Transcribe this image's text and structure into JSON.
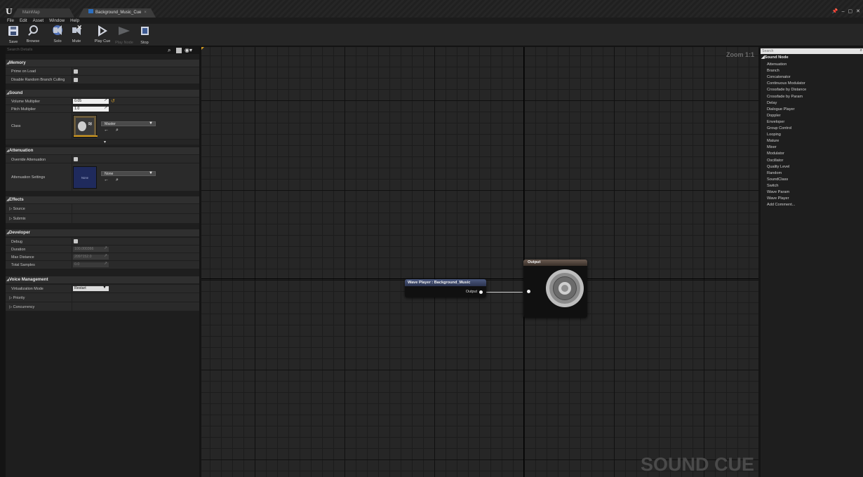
{
  "titlebar": {
    "tabs": [
      {
        "label": "MainMap"
      },
      {
        "label": "Background_Music_Cue",
        "close": "×"
      }
    ],
    "window_controls": {
      "pin": "📌",
      "minimize": "–",
      "maximize": "▢",
      "close": "✕"
    }
  },
  "menubar": [
    "File",
    "Edit",
    "Asset",
    "Window",
    "Help"
  ],
  "toolbar": {
    "save": "Save",
    "browse": "Browse",
    "solo": "Solo",
    "mute": "Mute",
    "play_cue": "Play Cue",
    "play_node": "Play Node",
    "stop": "Stop"
  },
  "details": {
    "search_placeholder": "Search Details",
    "categories": {
      "memory": "Memory",
      "sound": "Sound",
      "attenuation": "Attenuation",
      "effects": "Effects",
      "developer": "Developer",
      "voice_management": "Voice Management"
    },
    "memory": {
      "prime_on_load": "Prime on Load",
      "disable_random_branch_culling": "Disable Random Branch Culling"
    },
    "sound": {
      "volume_multiplier_label": "Volume Multiplier",
      "volume_multiplier": "0.05",
      "pitch_multiplier_label": "Pitch Multiplier",
      "pitch_multiplier": "1.0",
      "class_label": "Class",
      "class_value": "Master"
    },
    "attenuation": {
      "override_label": "Override Attenuation",
      "settings_label": "Attenuation Settings",
      "settings_value": "None",
      "thumb_text": "None"
    },
    "effects": {
      "source": "Source",
      "submix": "Submix"
    },
    "developer": {
      "debug": "Debug",
      "duration_label": "Duration",
      "duration": "100.000366",
      "max_distance_label": "Max Distance",
      "max_distance": "2097152.0",
      "total_samples_label": "Total Samples",
      "total_samples": "0.0"
    },
    "voice_management": {
      "virtualization_mode_label": "Virtualization Mode",
      "virtualization_mode": "Restart",
      "priority": "Priority",
      "concurrency": "Concurrency"
    },
    "glyphs": {
      "tri_open": "◢",
      "tri_closed": "▷",
      "spin": "↗",
      "reset": "↺",
      "dropdown": "▼",
      "expander": "▾",
      "asset_ops": "← ⌕"
    }
  },
  "graph": {
    "zoom": "Zoom 1:1",
    "watermark": "SOUND CUE",
    "wave_player_node": {
      "title": "Wave Player : Background_Music",
      "output_pin": "Output"
    },
    "output_node": {
      "title": "Output"
    }
  },
  "palette": {
    "search_placeholder": "Search",
    "category": "Sound Node",
    "items": [
      "Attenuation",
      "Branch",
      "Concatenator",
      "Continuous Modulator",
      "Crossfade by Distance",
      "Crossfade by Param",
      "Delay",
      "Dialogue Player",
      "Doppler",
      "Enveloper",
      "Group Control",
      "Looping",
      "Mature",
      "Mixer",
      "Modulator",
      "Oscillator",
      "Quality Level",
      "Random",
      "SoundClass",
      "Switch",
      "Wave Param",
      "Wave Player",
      "Add Comment..."
    ]
  },
  "colors": {
    "accent_orange": "#d29a20",
    "node_header_blue": "#4c5a80",
    "output_header": "#6a5a50"
  }
}
